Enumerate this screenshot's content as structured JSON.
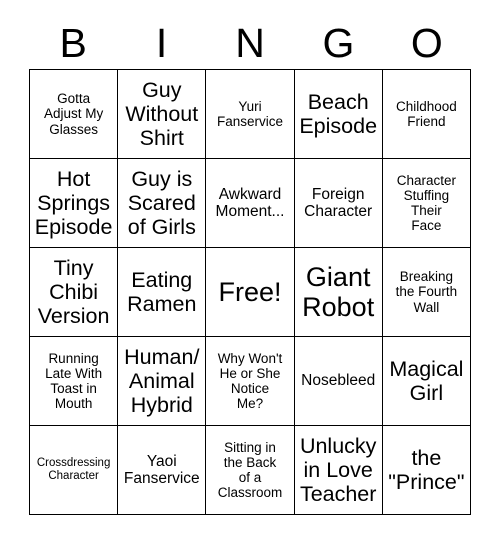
{
  "card": {
    "title_letters": [
      "B",
      "I",
      "N",
      "G",
      "O"
    ],
    "free_space_label": "Free!",
    "colors": {
      "background": "#ffffff",
      "border": "#000000",
      "text": "#000000"
    },
    "grid": {
      "columns": 5,
      "rows": 5
    },
    "cells": [
      [
        {
          "text": "Gotta\nAdjust My\nGlasses",
          "size": "fs-sm"
        },
        {
          "text": "Guy\nWithout\nShirt",
          "size": "fs-xl"
        },
        {
          "text": "Yuri\nFanservice",
          "size": "fs-sm"
        },
        {
          "text": "Beach\nEpisode",
          "size": "fs-xl"
        },
        {
          "text": "Childhood\nFriend",
          "size": "fs-sm"
        }
      ],
      [
        {
          "text": "Hot\nSprings\nEpisode",
          "size": "fs-xl"
        },
        {
          "text": "Guy is\nScared\nof Girls",
          "size": "fs-xl"
        },
        {
          "text": "Awkward\nMoment...",
          "size": "fs-md"
        },
        {
          "text": "Foreign\nCharacter",
          "size": "fs-md"
        },
        {
          "text": "Character\nStuffing\nTheir\nFace",
          "size": "fs-sm"
        }
      ],
      [
        {
          "text": "Tiny\nChibi\nVersion",
          "size": "fs-xl"
        },
        {
          "text": "Eating\nRamen",
          "size": "fs-xl"
        },
        {
          "text": "Free!",
          "size": "fs-xxl"
        },
        {
          "text": "Giant\nRobot",
          "size": "fs-xxl"
        },
        {
          "text": "Breaking\nthe Fourth\nWall",
          "size": "fs-sm"
        }
      ],
      [
        {
          "text": "Running\nLate With\nToast in\nMouth",
          "size": "fs-sm"
        },
        {
          "text": "Human/\nAnimal\nHybrid",
          "size": "fs-xl"
        },
        {
          "text": "Why Won't\nHe or She\nNotice\nMe?",
          "size": "fs-sm"
        },
        {
          "text": "Nosebleed",
          "size": "fs-md"
        },
        {
          "text": "Magical\nGirl",
          "size": "fs-xl"
        }
      ],
      [
        {
          "text": "Crossdressing\nCharacter",
          "size": "fs-xs"
        },
        {
          "text": "Yaoi\nFanservice",
          "size": "fs-md"
        },
        {
          "text": "Sitting in\nthe Back\nof a\nClassroom",
          "size": "fs-sm"
        },
        {
          "text": "Unlucky\nin Love\nTeacher",
          "size": "fs-xl"
        },
        {
          "text": "the\n\"Prince\"",
          "size": "fs-xl"
        }
      ]
    ]
  }
}
